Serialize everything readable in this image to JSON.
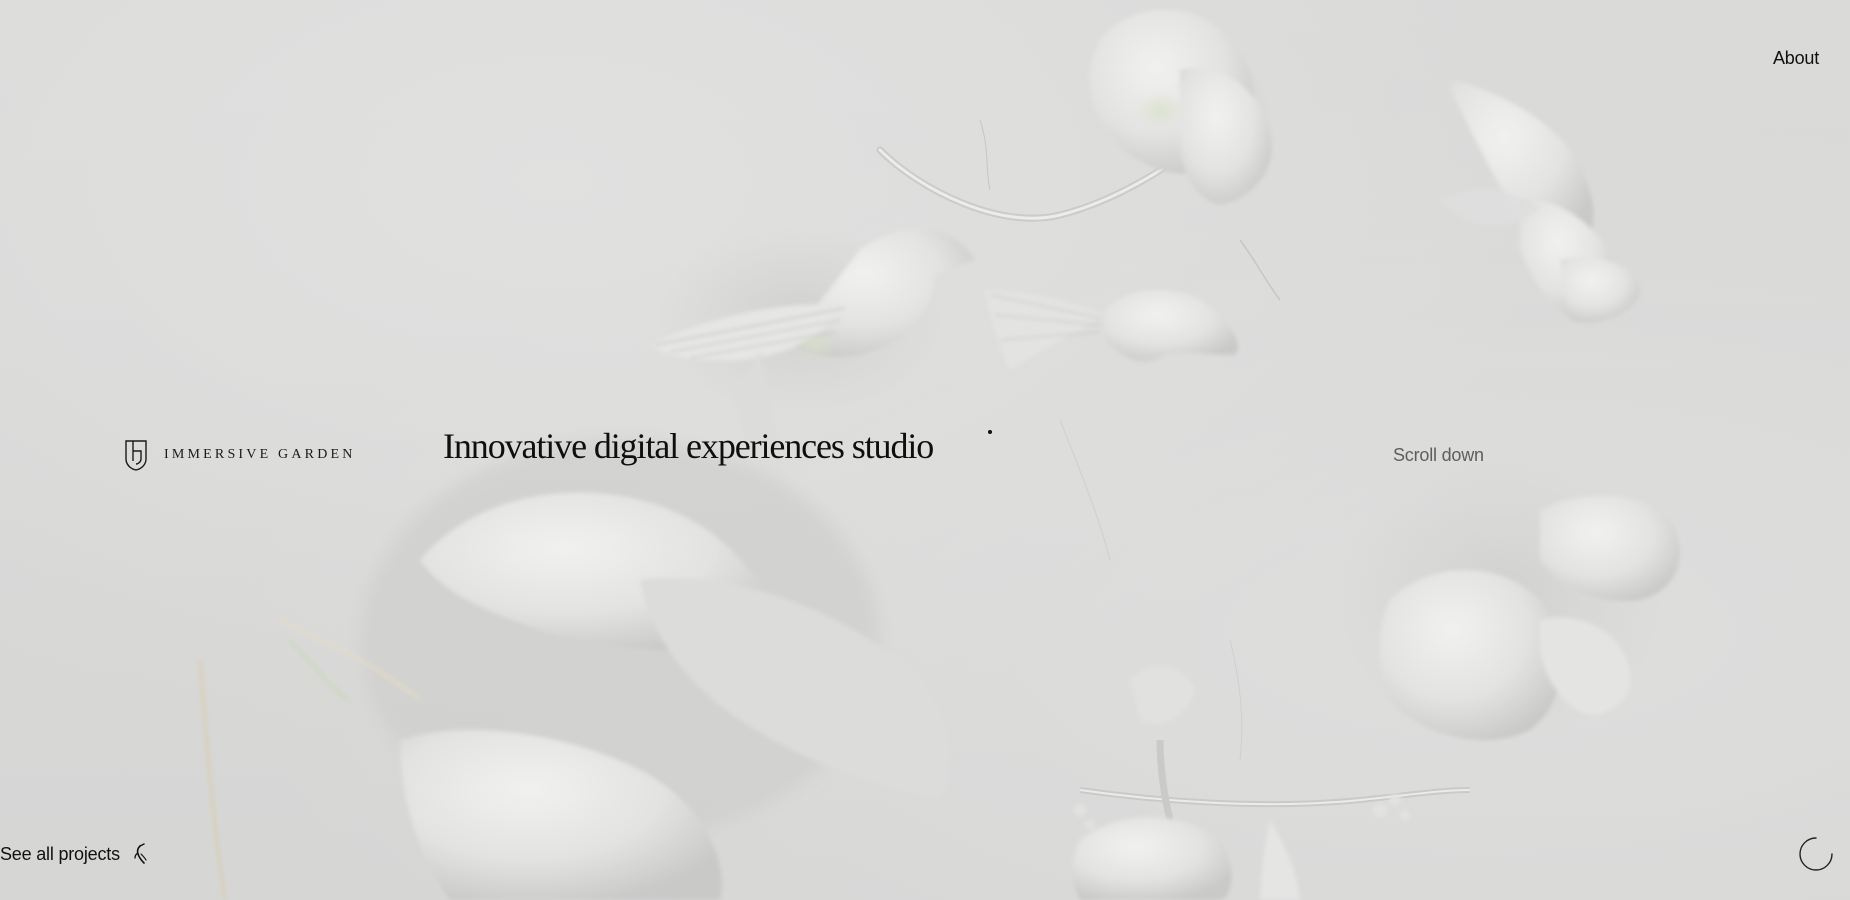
{
  "nav": {
    "about_label": "About"
  },
  "brand": {
    "name": "IMMERSIVE GARDEN",
    "logo_icon": "ig-shield-logo-icon"
  },
  "hero": {
    "tagline": "Innovative digital experiences studio",
    "scroll_hint": "Scroll down"
  },
  "footer": {
    "projects_label": "See all projects",
    "projects_icon": "hummingbird-icon",
    "loader_icon": "loading-ring-icon"
  },
  "colors": {
    "background": "#d9d9d8",
    "text_primary": "#111111",
    "text_muted": "#5e5e5e"
  }
}
